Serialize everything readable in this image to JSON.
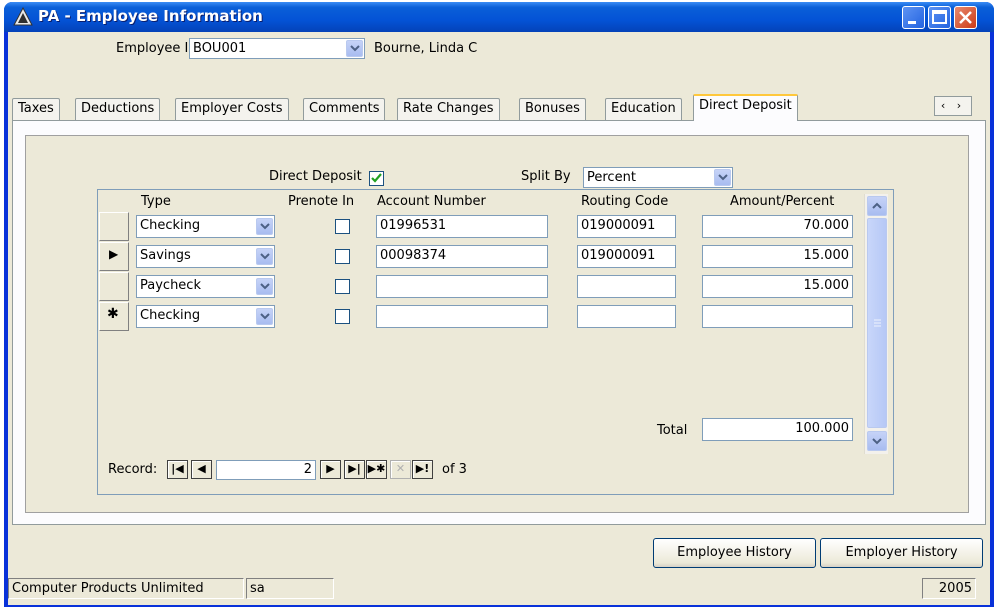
{
  "window": {
    "title": "PA - Employee Information"
  },
  "employee": {
    "id_label": "Employee ID",
    "id_value": "BOU001",
    "name": "Bourne, Linda C"
  },
  "tabs": [
    {
      "label": "Taxes"
    },
    {
      "label": "Deductions"
    },
    {
      "label": "Employer Costs"
    },
    {
      "label": "Comments"
    },
    {
      "label": "Rate Changes"
    },
    {
      "label": "Bonuses"
    },
    {
      "label": "Education"
    },
    {
      "label": "Direct Deposit"
    }
  ],
  "tab_scroll_arrows": "‹ ›",
  "direct_deposit": {
    "label": "Direct Deposit",
    "checked": true,
    "split_by_label": "Split By",
    "split_by_value": "Percent"
  },
  "grid": {
    "headers": {
      "type": "Type",
      "prenote": "Prenote In",
      "account": "Account Number",
      "routing": "Routing Code",
      "amount": "Amount/Percent"
    },
    "rows": [
      {
        "selector": "",
        "type": "Checking",
        "prenote": false,
        "account": "01996531",
        "routing": "019000091",
        "amount": "70.000"
      },
      {
        "selector": "▶",
        "type": "Savings",
        "prenote": false,
        "account": "00098374",
        "routing": "019000091",
        "amount": "15.000"
      },
      {
        "selector": "",
        "type": "Paycheck",
        "prenote": false,
        "account": "",
        "routing": "",
        "amount": "15.000"
      },
      {
        "selector": "✱",
        "type": "Checking",
        "prenote": false,
        "account": "",
        "routing": "",
        "amount": ""
      }
    ],
    "total_label": "Total",
    "total_value": "100.000"
  },
  "record_nav": {
    "label": "Record:",
    "current": "2",
    "of_text": "of 3"
  },
  "buttons": {
    "employee_history": "Employee History",
    "employer_history": "Employer History"
  },
  "status_bar": {
    "company": "Computer Products Unlimited",
    "user": "sa",
    "year": "2005"
  },
  "colors": {
    "titlebar": "#0453d6",
    "client_bg": "#ece9d8",
    "checkbox_check": "#21a121"
  }
}
